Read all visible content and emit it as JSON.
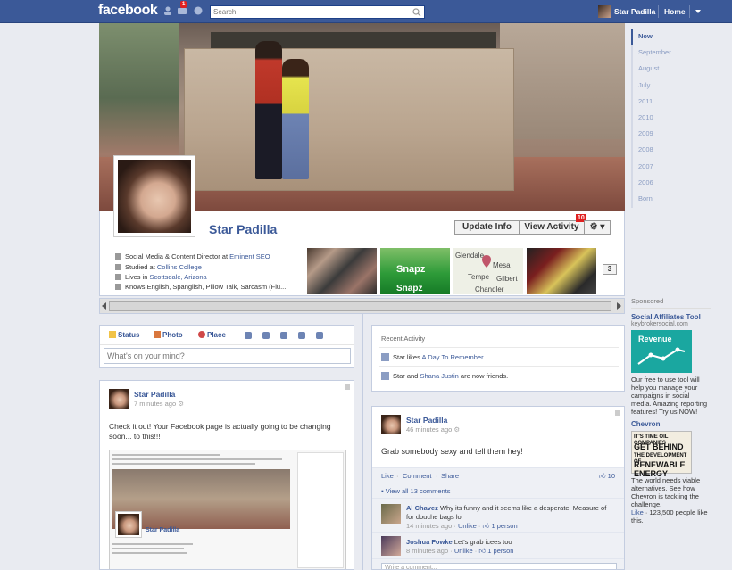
{
  "topbar": {
    "logo": "facebook",
    "notification_badge": "1",
    "search_placeholder": "Search",
    "user_name": "Star Padilla",
    "home_label": "Home",
    "brand_color": "#3b5998"
  },
  "profile": {
    "name": "Star Padilla",
    "update_info_label": "Update Info",
    "view_activity_label": "View Activity",
    "view_activity_badge": "10",
    "about": [
      {
        "icon": "briefcase-icon",
        "prefix": "Social Media & Content Director at ",
        "link": "Eminent SEO"
      },
      {
        "icon": "school-icon",
        "prefix": "Studied at ",
        "link": "Collins College"
      },
      {
        "icon": "home-icon",
        "prefix": "Lives in ",
        "link": "Scottsdale, Arizona"
      },
      {
        "icon": "language-icon",
        "prefix": "Knows English, Spanglish, Pillow Talk, Sarcasm (Flu...",
        "link": ""
      }
    ],
    "more_button": "3",
    "map_labels": [
      "Glendale",
      "Mesa",
      "Tempe",
      "Gilbert",
      "Chandler"
    ],
    "likes_thumb_text": "Snapz",
    "likes_thumb_text2": "Snapz"
  },
  "timeline_nav": [
    "Now",
    "September",
    "August",
    "July",
    "2011",
    "2010",
    "2009",
    "2008",
    "2007",
    "2006",
    "Born"
  ],
  "composer": {
    "tabs": [
      "Status",
      "Photo",
      "Place"
    ],
    "placeholder": "What's on your mind?"
  },
  "recent_activity": {
    "title": "Recent Activity",
    "row1_prefix": "Star likes ",
    "row1_link": "A Day To Remember",
    "row1_suffix": ".",
    "row2_prefix": "Star and ",
    "row2_link": "Shana Justin",
    "row2_suffix": " are now friends."
  },
  "post_left": {
    "author": "Star Padilla",
    "time": "7 minutes ago",
    "text": "Check it out! Your Facebook page is actually going to be changing soon... to this!!!",
    "embed_name": "Star Padilla"
  },
  "post_right": {
    "author": "Star Padilla",
    "time": "46 minutes ago",
    "text": "Grab somebody sexy and tell them hey!",
    "action_like": "Like",
    "action_comment": "Comment",
    "action_share": "Share",
    "like_count": "10",
    "view_all": "View all 13 comments",
    "comments": [
      {
        "name": "Al Chavez",
        "text": "Why its funny and it seems like a desperate. Measure of for douche bags lol",
        "time": "14 minutes ago",
        "unlike": "Unlike",
        "likes": "1 person"
      },
      {
        "name": "Joshua Fowke",
        "text": "Let's grab icees too",
        "time": "8 minutes ago",
        "unlike": "Unlike",
        "likes": "1 person"
      }
    ],
    "write_comment": "Write a comment..."
  },
  "sponsored": {
    "header": "Sponsored",
    "ad1_title": "Social Affiliates Tool",
    "ad1_url": "keybrokersocial.com",
    "ad1_image_label": "Revenue",
    "ad1_body": "Our free to use tool will help you manage your campaigns in social media. Amazing reporting features! Try us NOW!",
    "ad2_title": "Chevron",
    "ad2_image_lines": [
      "IT'S TIME OIL COMPANIES",
      "GET BEHIND",
      "THE DEVELOPMENT OF",
      "RENEWABLE ENERGY"
    ],
    "ad2_body": "The world needs viable alternatives. See how Chevron is tackling the challenge.",
    "ad2_like": "Like",
    "ad2_like_count": " · 123,500 people like this."
  }
}
